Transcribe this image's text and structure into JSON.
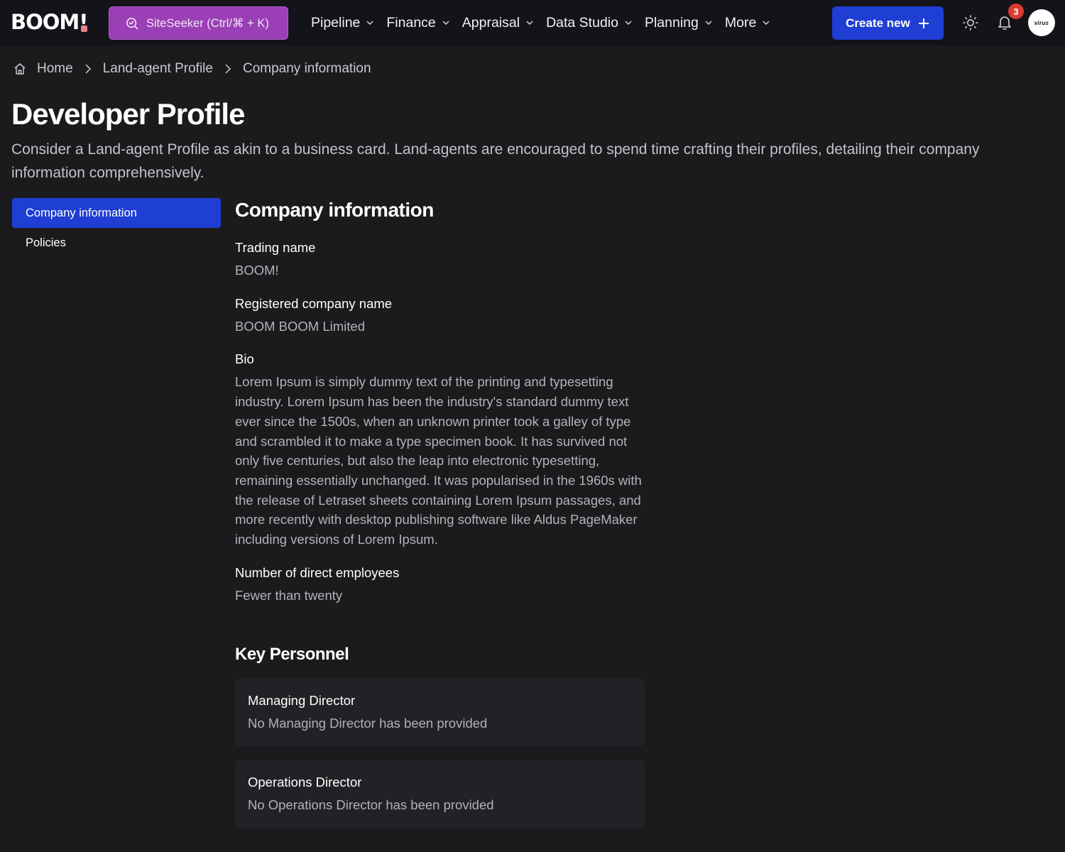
{
  "header": {
    "logo": "BOOM",
    "logo_bang": "!",
    "search_label": "SiteSeeker (Ctrl/⌘ + K)",
    "nav": [
      {
        "label": "Pipeline"
      },
      {
        "label": "Finance"
      },
      {
        "label": "Appraisal"
      },
      {
        "label": "Data Studio"
      },
      {
        "label": "Planning"
      },
      {
        "label": "More"
      }
    ],
    "create_label": "Create new",
    "notification_count": "3",
    "avatar_text": "virus"
  },
  "breadcrumb": {
    "items": [
      "Home",
      "Land-agent Profile",
      "Company information"
    ]
  },
  "page": {
    "title": "Developer Profile",
    "description": "Consider a Land-agent Profile as akin to a business card. Land-agents are encouraged to spend time crafting their profiles, detailing their company information comprehensively."
  },
  "sidenav": {
    "items": [
      {
        "label": "Company information",
        "active": true
      },
      {
        "label": "Policies",
        "active": false
      }
    ]
  },
  "company": {
    "section_title": "Company information",
    "fields": [
      {
        "label": "Trading name",
        "value": "BOOM!"
      },
      {
        "label": "Registered company name",
        "value": "BOOM BOOM Limited"
      },
      {
        "label": "Bio",
        "value": "Lorem Ipsum is simply dummy text of the printing and typesetting industry. Lorem Ipsum has been the industry's standard dummy text ever since the 1500s, when an unknown printer took a galley of type and scrambled it to make a type specimen book. It has survived not only five centuries, but also the leap into electronic typesetting, remaining essentially unchanged. It was popularised in the 1960s with the release of Letraset sheets containing Lorem Ipsum passages, and more recently with desktop publishing software like Aldus PageMaker including versions of Lorem Ipsum."
      },
      {
        "label": "Number of direct employees",
        "value": "Fewer than twenty"
      }
    ]
  },
  "key_personnel": {
    "title": "Key Personnel",
    "cards": [
      {
        "role": "Managing Director",
        "value": "No Managing Director has been provided"
      },
      {
        "role": "Operations Director",
        "value": "No Operations Director has been provided"
      }
    ]
  },
  "colors": {
    "background": "#1b1b1e",
    "header": "#141319",
    "primary": "#1f3fd4",
    "search": "#9a3fb5",
    "badge": "#dc3a2f"
  }
}
